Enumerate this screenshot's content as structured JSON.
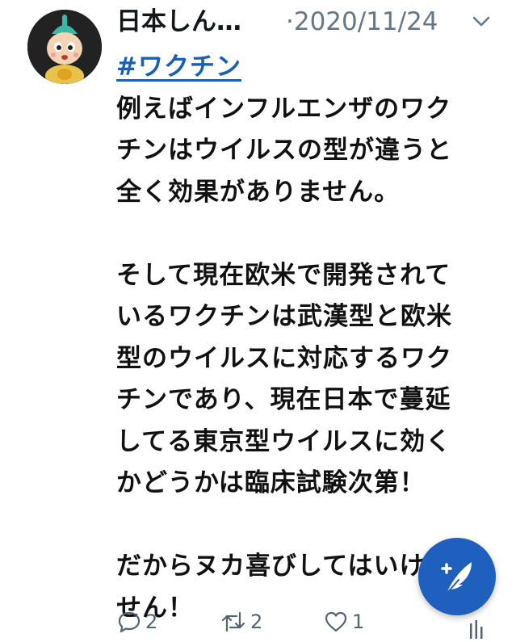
{
  "tweet": {
    "display_name": "日本しん…",
    "meta": "·2020/11/24",
    "hashtag": "#ワクチン",
    "lines": [
      "例えばインフルエンザのワク",
      "チンはウイルスの型が違うと",
      "全く効果がありません。",
      "",
      "そして現在欧米で開発されて",
      "いるワクチンは武漢型と欧米",
      "型のウイルスに対応するワク",
      "チンであり、現在日本で蔓延",
      "してる東京型ウイルスに効く",
      "かどうかは臨床試験次第！",
      "",
      "だからヌカ喜びしてはいけま",
      "せん！"
    ]
  },
  "actions": {
    "reply_count": "2",
    "retweet_count": "2",
    "like_count": "1"
  },
  "icons": {
    "avatar": "avatar-character-icon",
    "menu": "chevron-down-icon",
    "reply": "reply-icon",
    "retweet": "retweet-icon",
    "like": "heart-icon",
    "compose": "compose-feather-icon"
  },
  "colors": {
    "hashtag": "#1b5fb5",
    "fab": "#1f5fbd",
    "meta": "#657786"
  }
}
